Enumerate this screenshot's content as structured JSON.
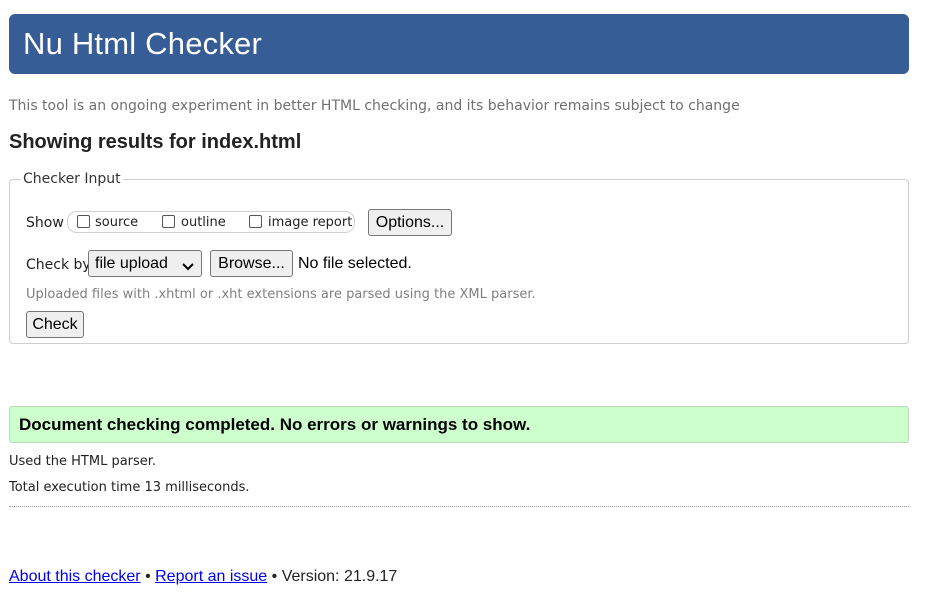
{
  "header": {
    "title": "Nu Html Checker"
  },
  "tagline": "This tool is an ongoing experiment in better HTML checking, and its behavior remains subject to change",
  "results_heading": "Showing results for index.html",
  "checker_input": {
    "legend": "Checker Input",
    "show_label": "Show",
    "checkboxes": [
      {
        "label": "source",
        "checked": false
      },
      {
        "label": "outline",
        "checked": false
      },
      {
        "label": "image report",
        "checked": false
      }
    ],
    "options_button": "Options...",
    "check_by_label": "Check by",
    "check_by_select": {
      "selected": "file upload"
    },
    "browse_button": "Browse...",
    "file_status": "No file selected.",
    "note": "Uploaded files with .xhtml or .xht extensions are parsed using the XML parser.",
    "check_button": "Check"
  },
  "result": {
    "message": "Document checking completed. No errors or warnings to show.",
    "background_color": "#ccffcc"
  },
  "info": {
    "parser": "Used the HTML parser.",
    "execution_time": "Total execution time 13 milliseconds."
  },
  "footer": {
    "about_link": "About this checker",
    "separator1": " • ",
    "report_link": "Report an issue",
    "separator2": " • ",
    "version": "Version: 21.9.17"
  },
  "colors": {
    "banner": "#365d95",
    "link": "#0000ee"
  }
}
